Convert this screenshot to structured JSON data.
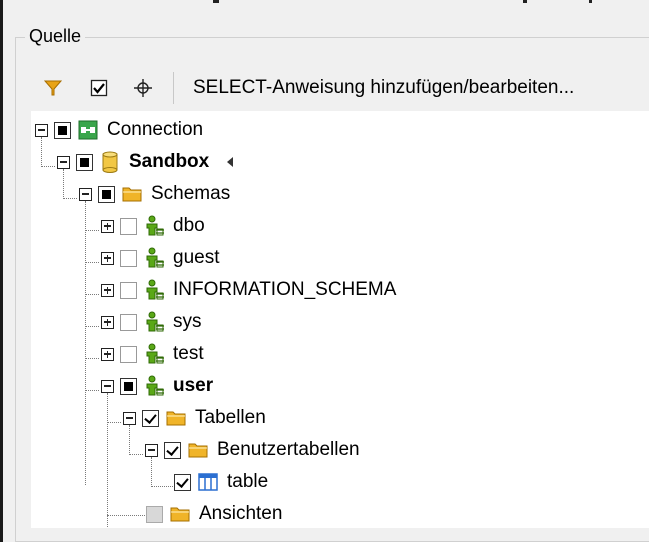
{
  "group": {
    "label": "Quelle"
  },
  "toolbar": {
    "filter_icon": "filter-icon",
    "check_icon": "checkmark-icon",
    "target_icon": "crosshair-icon",
    "select_statement_label": "SELECT-Anweisung hinzufügen/bearbeiten..."
  },
  "tree": {
    "connection": {
      "label": "Connection",
      "icon": "connection-icon",
      "expanded": true,
      "check": "filled"
    },
    "sandbox": {
      "label": "Sandbox",
      "icon": "database-icon",
      "expanded": true,
      "check": "filled"
    },
    "schemas": {
      "label": "Schemas",
      "icon": "folder-icon",
      "expanded": true,
      "check": "filled"
    },
    "dbo": {
      "label": "dbo",
      "icon": "schema-user-icon",
      "expanded": false,
      "check": "empty"
    },
    "guest": {
      "label": "guest",
      "icon": "schema-user-icon",
      "expanded": false,
      "check": "empty"
    },
    "information_schema": {
      "label": "INFORMATION_SCHEMA",
      "icon": "schema-user-icon",
      "expanded": false,
      "check": "empty"
    },
    "sys": {
      "label": "sys",
      "icon": "schema-user-icon",
      "expanded": false,
      "check": "empty"
    },
    "test": {
      "label": "test",
      "icon": "schema-user-icon",
      "expanded": false,
      "check": "empty"
    },
    "user": {
      "label": "user",
      "icon": "schema-user-icon",
      "expanded": true,
      "check": "filled"
    },
    "tabellen": {
      "label": "Tabellen",
      "icon": "folder-icon",
      "expanded": true,
      "check": "checked"
    },
    "benutzertabellen": {
      "label": "Benutzertabellen",
      "icon": "folder-icon",
      "expanded": true,
      "check": "checked"
    },
    "table": {
      "label": "table",
      "icon": "table-icon",
      "check": "checked"
    },
    "ansichten": {
      "label": "Ansichten",
      "icon": "folder-icon",
      "check": "gray"
    }
  },
  "colors": {
    "filter": "#e8a317",
    "schema_green": "#5aa817",
    "folder": "#f0b429",
    "database": "#f2c744",
    "table_blue": "#2b6fd1",
    "connection_green": "#3aa64b"
  }
}
